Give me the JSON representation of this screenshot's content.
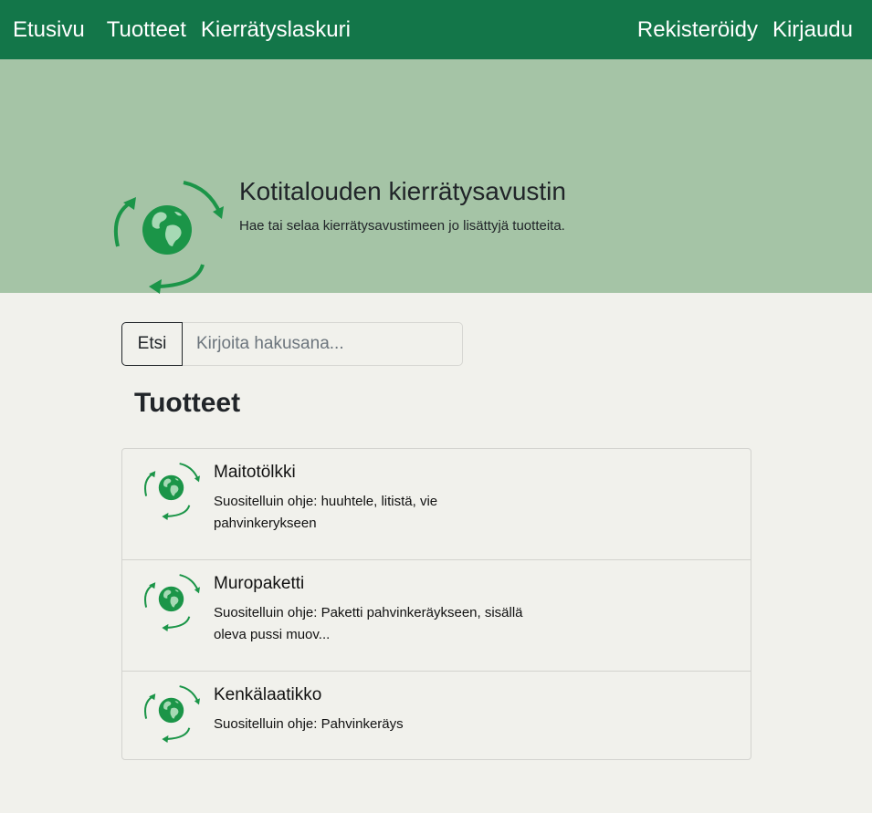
{
  "navbar": {
    "left": [
      "Etusivu",
      "Tuotteet",
      "Kierrätyslaskuri"
    ],
    "right": [
      "Rekisteröidy",
      "Kirjaudu"
    ],
    "bg_color": "#137649"
  },
  "hero": {
    "title": "Kotitalouden kierrätysavustin",
    "subtitle": "Hae tai selaa kierrätysavustimeen jo lisättyjä tuotteita.",
    "logo_icon": "recycle-globe-icon",
    "bg_color": "#a5c4a6"
  },
  "search": {
    "button_label": "Etsi",
    "placeholder": "Kirjoita hakusana...",
    "value": ""
  },
  "products_section": {
    "title": "Tuotteet",
    "items": [
      {
        "name": "Maitotölkki",
        "description": "Suositelluin ohje: huuhtele, litistä, vie pahvinkerykseen"
      },
      {
        "name": "Muropaketti",
        "description": "Suositelluin ohje: Paketti pahvinkeräykseen, sisällä oleva pussi muov..."
      },
      {
        "name": "Kenkälaatikko",
        "description": "Suositelluin ohje: Pahvinkeräys"
      }
    ]
  },
  "colors": {
    "accent_green": "#1b9548",
    "page_bg": "#f1f1ec"
  }
}
